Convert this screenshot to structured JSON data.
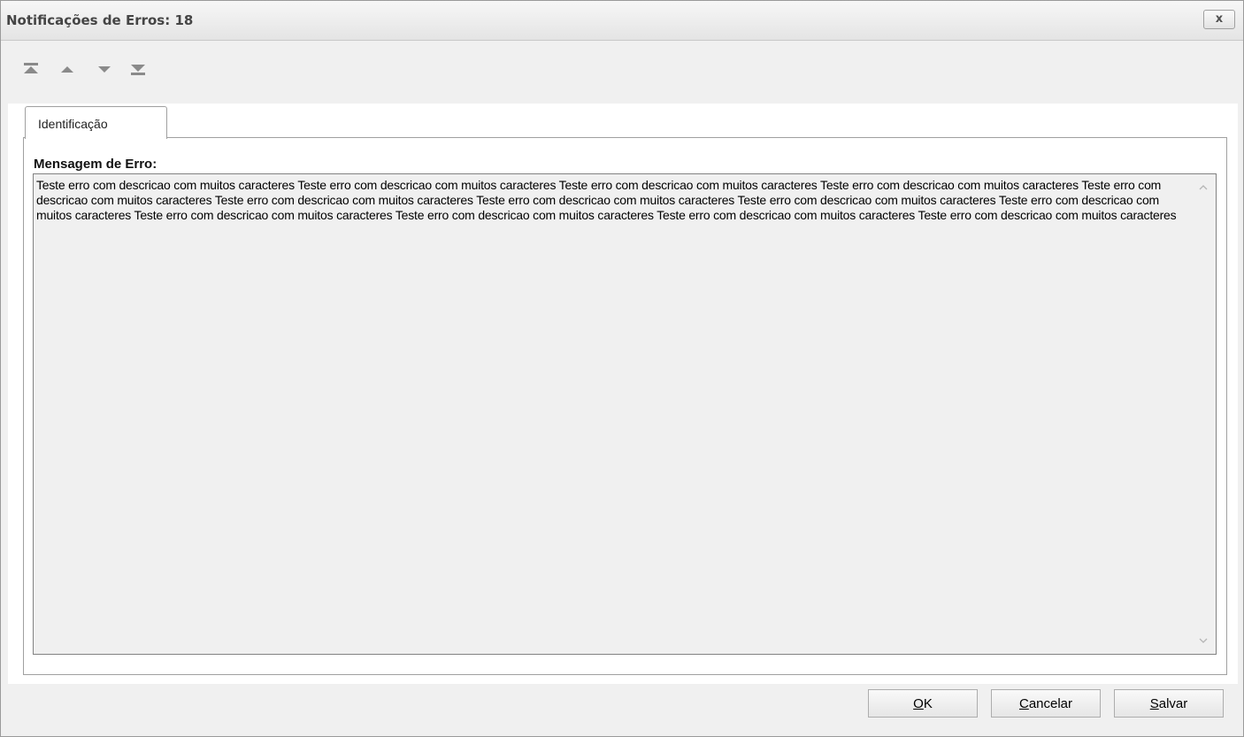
{
  "window": {
    "title": "Notificações de Erros: 18",
    "close_label": "x"
  },
  "toolbar": {
    "icons": [
      "first-record-icon",
      "previous-record-icon",
      "next-record-icon",
      "last-record-icon"
    ]
  },
  "tabs": [
    {
      "label": "Identificação",
      "active": true
    }
  ],
  "form": {
    "error_label": "Mensagem de Erro:",
    "error_message": "Teste erro com descricao com muitos caracteres Teste erro com descricao com muitos caracteres Teste erro com descricao com muitos caracteres Teste erro com descricao com muitos caracteres Teste erro com descricao com muitos caracteres Teste erro com descricao com muitos caracteres Teste erro com descricao com muitos caracteres Teste erro com descricao com muitos caracteres Teste erro com descricao com muitos caracteres Teste erro com descricao com muitos caracteres Teste erro com descricao com muitos caracteres Teste erro com descricao com muitos caracteres Teste erro com descricao com muitos caracteres"
  },
  "buttons": {
    "ok": {
      "mnemonic": "O",
      "rest": "K"
    },
    "cancel": {
      "mnemonic": "C",
      "rest": "ancelar"
    },
    "save": {
      "mnemonic": "S",
      "rest": "alvar"
    }
  },
  "colors": {
    "window_bg": "#f0f0f0",
    "memo_bg": "#f0f0f0",
    "title_text": "#454545",
    "icon_gray": "#8a8a8a"
  }
}
